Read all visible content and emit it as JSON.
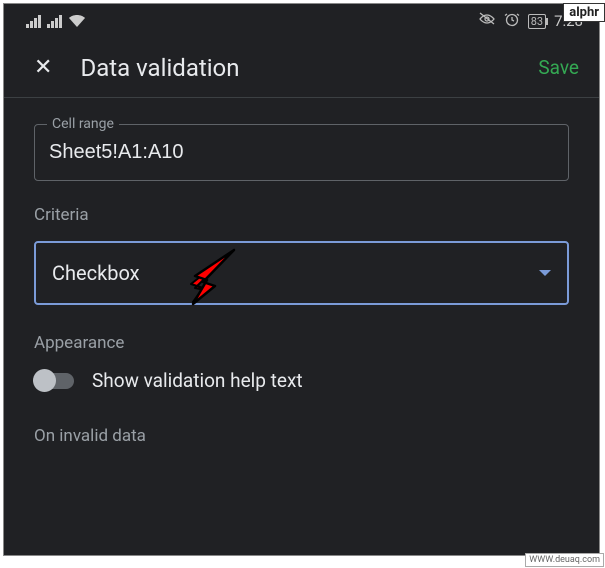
{
  "watermarks": {
    "alphr": "alphr",
    "deuaq": "WWW.deuaq.com"
  },
  "status_bar": {
    "battery_percent": "83",
    "time": "7:28"
  },
  "header": {
    "title": "Data validation",
    "save_label": "Save"
  },
  "cell_range": {
    "label": "Cell range",
    "value": "Sheet5!A1:A10"
  },
  "criteria": {
    "label": "Criteria",
    "selected": "Checkbox"
  },
  "appearance": {
    "label": "Appearance",
    "toggle_label": "Show validation help text",
    "toggle_state": false
  },
  "invalid_data": {
    "label": "On invalid data"
  }
}
